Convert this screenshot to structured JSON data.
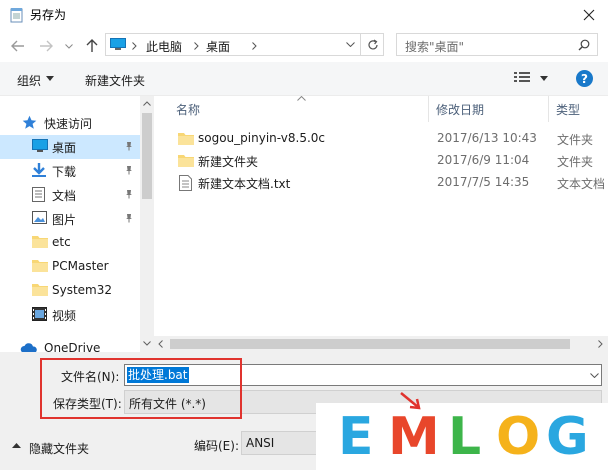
{
  "window": {
    "title": "另存为"
  },
  "address": {
    "crumbs": [
      "此电脑",
      "桌面"
    ]
  },
  "search": {
    "placeholder": "搜索\"桌面\""
  },
  "toolbar": {
    "organize": "组织",
    "new_folder": "新建文件夹"
  },
  "sidebar": {
    "quick_access": "快速访问",
    "items": [
      {
        "label": "桌面",
        "icon": "desktop-icon",
        "pinned": true,
        "selected": true
      },
      {
        "label": "下载",
        "icon": "download-icon",
        "pinned": true
      },
      {
        "label": "文档",
        "icon": "document-icon",
        "pinned": true
      },
      {
        "label": "图片",
        "icon": "picture-icon",
        "pinned": true
      },
      {
        "label": "etc",
        "icon": "folder-icon"
      },
      {
        "label": "PCMaster",
        "icon": "folder-icon"
      },
      {
        "label": "System32",
        "icon": "folder-icon"
      },
      {
        "label": "视频",
        "icon": "video-icon"
      }
    ],
    "onedrive": "OneDrive"
  },
  "files": {
    "columns": {
      "name": "名称",
      "modified": "修改日期",
      "type": "类型"
    },
    "rows": [
      {
        "name": "sogou_pinyin-v8.5.0c",
        "modified": "2017/6/13 10:43",
        "type": "文件夹",
        "icon": "folder-icon"
      },
      {
        "name": "新建文件夹",
        "modified": "2017/6/9 11:04",
        "type": "文件夹",
        "icon": "folder-icon"
      },
      {
        "name": "新建文本文档.txt",
        "modified": "2017/7/5 14:35",
        "type": "文本文档",
        "icon": "text-file-icon"
      }
    ]
  },
  "save": {
    "filename_label": "文件名(N):",
    "filename_value": "批处理.bat",
    "filetype_label": "保存类型(T):",
    "filetype_value": "所有文件  (*.*)",
    "hide_folders": "隐藏文件夹",
    "encoding_label": "编码(E):",
    "encoding_value": "ANSI"
  },
  "watermark": {
    "letters": [
      "E",
      "M",
      "L",
      "O",
      "G"
    ],
    "colors": [
      "#2aa7e0",
      "#e8462b",
      "#3db54a",
      "#f5b21b",
      "#2aa7e0"
    ]
  },
  "colors": {
    "selection": "#cce8ff",
    "highlight": "#0078d7",
    "annotation": "#e0332e",
    "help": "#1979ca"
  }
}
